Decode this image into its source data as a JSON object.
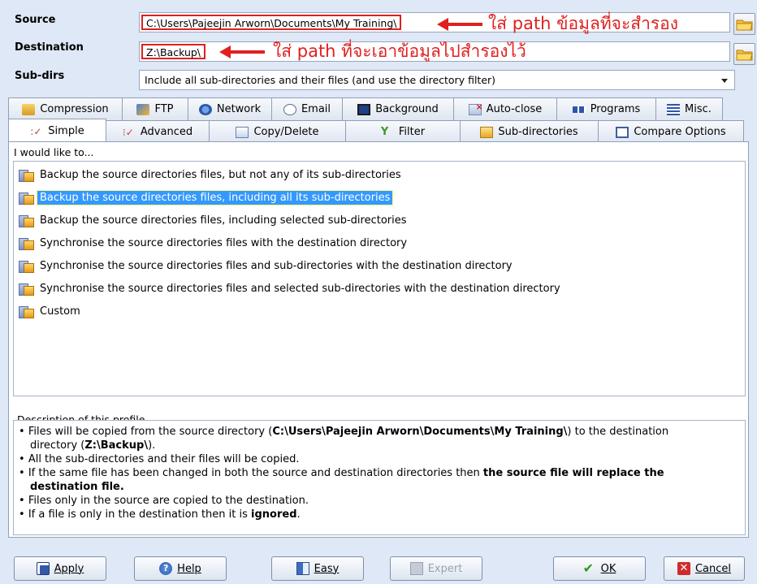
{
  "form": {
    "source_label": "Source",
    "source_value": "C:\\Users\\Pajeejin Arworn\\Documents\\My Training\\",
    "destination_label": "Destination",
    "destination_value": "Z:\\Backup\\",
    "subdirs_label": "Sub-dirs",
    "subdirs_value": "Include all sub-directories and their files (and use the directory filter)"
  },
  "annotations": {
    "source_note": "ใส่ path ข้อมูลที่จะสำรอง",
    "destination_note": "ใส่ path ที่จะเอาข้อมูลไปสำรองไว้"
  },
  "tabs_top": [
    {
      "label": "Compression",
      "icon": "compression-icon"
    },
    {
      "label": "FTP",
      "icon": "ftp-icon"
    },
    {
      "label": "Network",
      "icon": "network-icon"
    },
    {
      "label": "Email",
      "icon": "email-icon"
    },
    {
      "label": "Background",
      "icon": "background-icon"
    },
    {
      "label": "Auto-close",
      "icon": "auto-close-icon"
    },
    {
      "label": "Programs",
      "icon": "programs-icon"
    },
    {
      "label": "Misc.",
      "icon": "misc-icon"
    }
  ],
  "tabs_bottom": [
    {
      "label": "Simple",
      "icon": "simple-icon",
      "active": true
    },
    {
      "label": "Advanced",
      "icon": "advanced-icon"
    },
    {
      "label": "Copy/Delete",
      "icon": "copy-delete-icon"
    },
    {
      "label": "Filter",
      "icon": "filter-icon"
    },
    {
      "label": "Sub-directories",
      "icon": "sub-directories-icon"
    },
    {
      "label": "Compare Options",
      "icon": "compare-options-icon"
    }
  ],
  "simple": {
    "group_title": "I would like to...",
    "options": [
      "Backup the source directories files, but not any of its sub-directories",
      "Backup the source directories files, including all its sub-directories",
      "Backup the source directories files, including selected sub-directories",
      "Synchronise the source directories files with the destination directory",
      "Synchronise the source directories files and sub-directories with the destination directory",
      "Synchronise the source directories files and selected sub-directories with the destination directory",
      "Custom"
    ],
    "selected_index": 1
  },
  "description": {
    "title": "Description of this profile",
    "l1a": "Files will be copied from the source directory (",
    "l1b": "C:\\Users\\Pajeejin Arworn\\Documents\\My Training\\",
    "l1c": ") to the destination",
    "l2a": "directory (",
    "l2b": "Z:\\Backup\\",
    "l2c": ").",
    "l3": "All the sub-directories and their files will be copied.",
    "l4a": "If the same file has been changed in both the source and destination directories then ",
    "l4b": "the source file will replace the",
    "l5": "destination file.",
    "l6": "Files only in the source are copied to the destination.",
    "l7a": "If a file is only in the destination then it is ",
    "l7b": "ignored",
    "l7c": "."
  },
  "buttons": {
    "apply": "Apply",
    "help": "Help",
    "easy": "Easy",
    "expert": "Expert",
    "ok": "OK",
    "cancel": "Cancel"
  },
  "colors": {
    "accent_red": "#e02020",
    "selection_blue": "#3399ff"
  }
}
